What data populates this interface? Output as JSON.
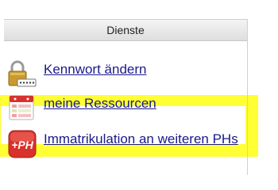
{
  "panel": {
    "header": "Dienste",
    "items": [
      {
        "label": "Kennwort ändern",
        "icon": "lock-password-icon"
      },
      {
        "label": "meine Ressourcen",
        "icon": "calendar-list-icon"
      },
      {
        "label": "Immatrikulation an weiteren PHs",
        "icon": "plus-ph-icon",
        "icon_text": "+PH"
      }
    ]
  },
  "colors": {
    "highlight": "#ffff33",
    "link": "#1a1a8a",
    "icon_red": "#d9312b"
  }
}
